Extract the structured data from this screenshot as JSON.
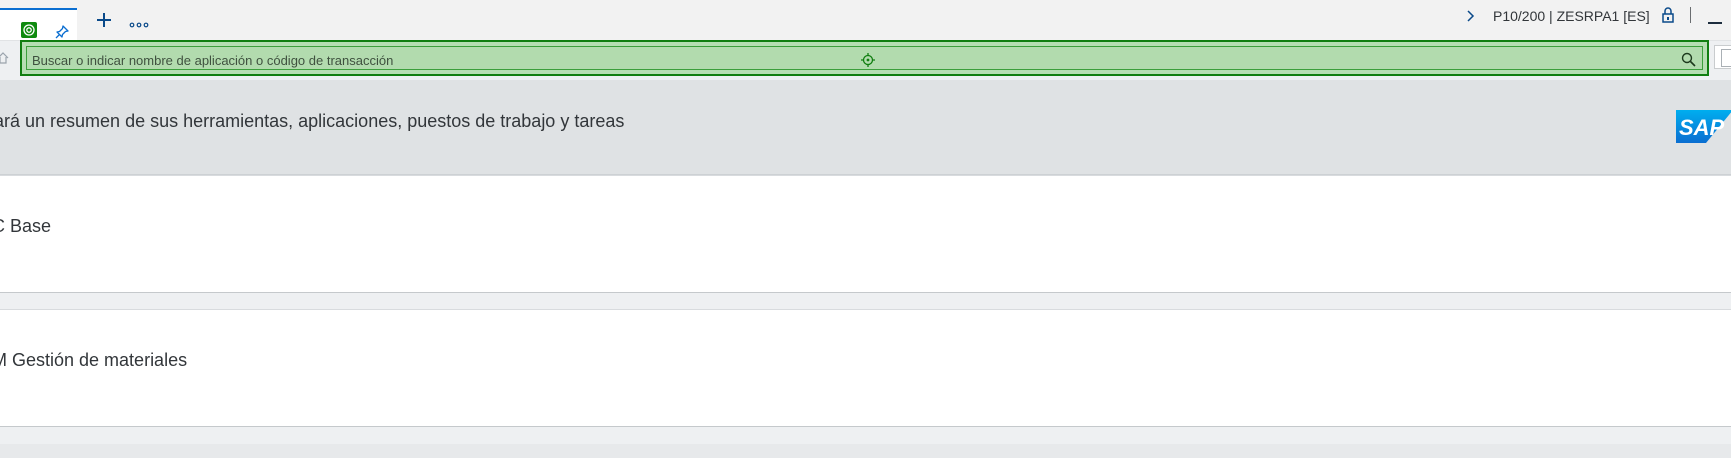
{
  "header": {
    "system_info": "P10/200 | ZESRPA1 [ES]"
  },
  "search": {
    "placeholder": "Buscar o indicar nombre de aplicación o código de transacción"
  },
  "welcome": {
    "text": "ará un resumen de sus herramientas, aplicaciones, puestos de trabajo y tareas"
  },
  "cards": [
    {
      "label": "C Base"
    },
    {
      "label": "M Gestión de materiales"
    }
  ],
  "colors": {
    "accent": "#0a6ed1",
    "highlight_border": "#107e10",
    "highlight_fill": "#b6deb3",
    "header_band": "#dfe2e4"
  },
  "icons": [
    "pin-icon",
    "add-tab-icon",
    "more-icon",
    "chevron-right-icon",
    "lock-icon",
    "minimize-icon",
    "home-icon",
    "target-icon",
    "search-icon",
    "sap-logo"
  ]
}
